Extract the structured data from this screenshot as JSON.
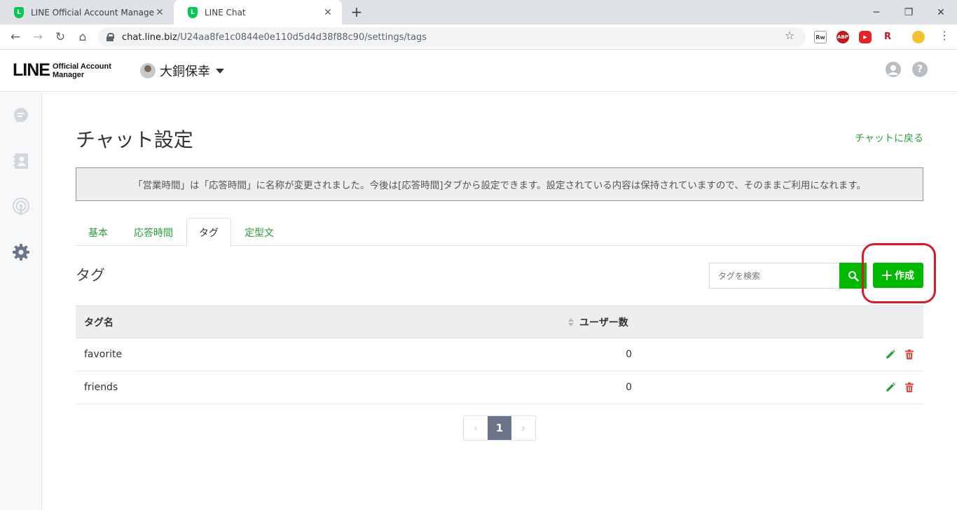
{
  "browser": {
    "tabs": [
      {
        "title": "LINE Official Account Manager"
      },
      {
        "title": "LINE Chat"
      }
    ],
    "url_domain": "chat.line.biz",
    "url_path": "/U24aa8fe1c0844e0e110d5d4d38f88c90/settings/tags"
  },
  "header": {
    "logo_main": "LINE",
    "logo_sub_1": "Official Account",
    "logo_sub_2": "Manager",
    "account_name": "大銅保幸"
  },
  "page": {
    "title": "チャット設定",
    "back_link": "チャットに戻る",
    "notice": "「営業時間」は「応答時間」に名称が変更されました。今後は[応答時間]タブから設定できます。設定されている内容は保持されていますので、そのままご利用になれます。"
  },
  "tabs": [
    {
      "label": "基本",
      "active": false
    },
    {
      "label": "応答時間",
      "active": false
    },
    {
      "label": "タグ",
      "active": true
    },
    {
      "label": "定型文",
      "active": false
    }
  ],
  "section": {
    "title": "タグ",
    "search_placeholder": "タグを検索",
    "create_label": "作成"
  },
  "table": {
    "col_name": "タグ名",
    "col_users": "ユーザー数",
    "rows": [
      {
        "name": "favorite",
        "count": "0"
      },
      {
        "name": "friends",
        "count": "0"
      }
    ]
  },
  "pagination": {
    "current": "1"
  },
  "colors": {
    "accent_green": "#00b900",
    "link_green": "#2a9d3a",
    "delete_red": "#e0443e",
    "highlight_red": "#d91a2a"
  }
}
